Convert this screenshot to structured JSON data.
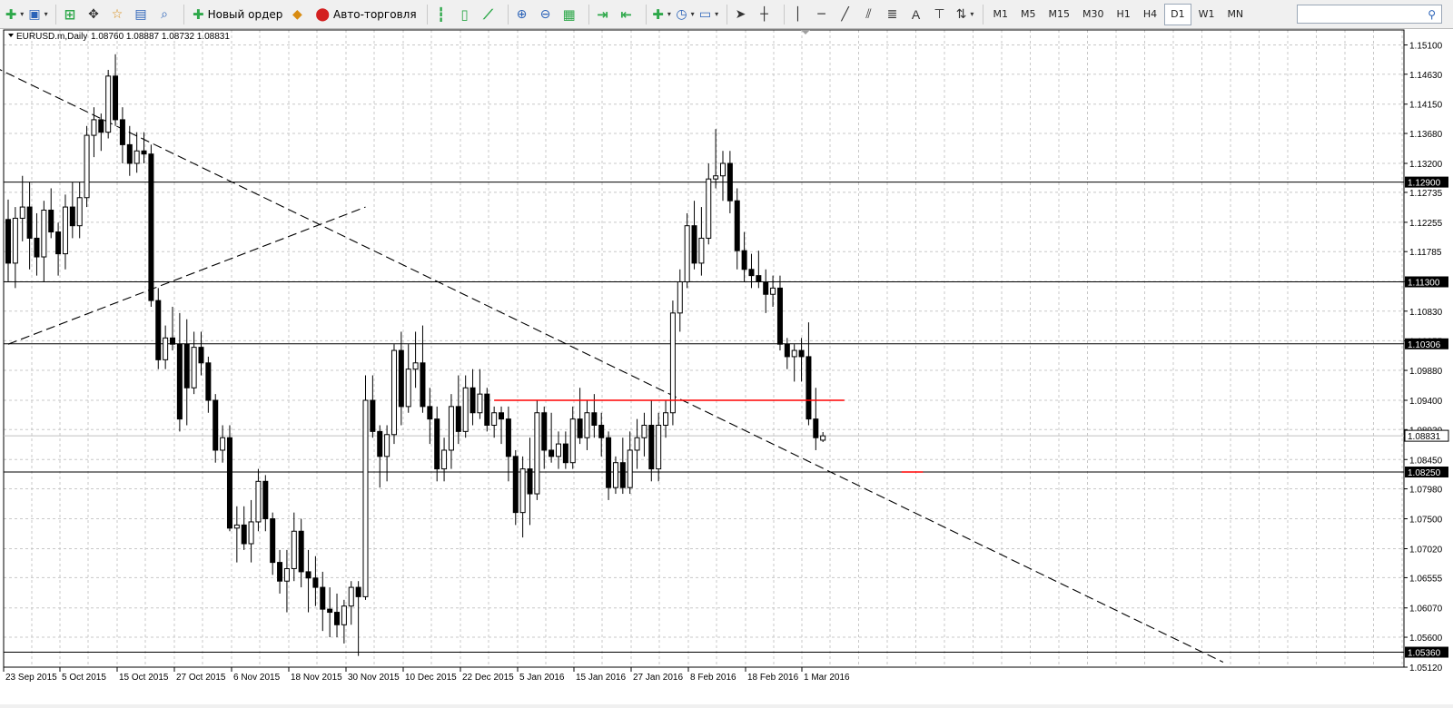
{
  "toolbar": {
    "new_order_label": "Новый ордер",
    "autotrading_label": "Авто-торговля",
    "timeframes": [
      "M1",
      "M5",
      "M15",
      "M30",
      "H1",
      "H4",
      "D1",
      "W1",
      "MN"
    ],
    "active_timeframe": "D1",
    "search_placeholder": ""
  },
  "chart_data": {
    "type": "candlestick",
    "symbol_label": "EURUSD.m,Daily",
    "ohlc_label": "1.08760 1.08887 1.08732 1.08831",
    "ylim": [
      1.0512,
      1.1534
    ],
    "y_ticks": [
      "1.15100",
      "1.14630",
      "1.14150",
      "1.13680",
      "1.13200",
      "1.12735",
      "1.12255",
      "1.11785",
      "1.11305",
      "1.10830",
      "1.10355",
      "1.09880",
      "1.09400",
      "1.08930",
      "1.08450",
      "1.07980",
      "1.07500",
      "1.07020",
      "1.06555",
      "1.06070",
      "1.05600",
      "1.05120"
    ],
    "x_labels": [
      "23 Sep 2015",
      "5 Oct 2015",
      "15 Oct 2015",
      "27 Oct 2015",
      "6 Nov 2015",
      "18 Nov 2015",
      "30 Nov 2015",
      "10 Dec 2015",
      "22 Dec 2015",
      "5 Jan 2016",
      "15 Jan 2016",
      "27 Jan 2016",
      "8 Feb 2016",
      "18 Feb 2016",
      "1 Mar 2016"
    ],
    "price_levels": [
      {
        "value": 1.129,
        "label": "1.12900"
      },
      {
        "value": 1.113,
        "label": "1.11300"
      },
      {
        "value": 1.10306,
        "label": "1.10306"
      },
      {
        "value": 1.0825,
        "label": "1.08250"
      },
      {
        "value": 1.0536,
        "label": "1.05360"
      }
    ],
    "current_price": {
      "value": 1.08831,
      "label": "1.08831"
    },
    "candles": [
      [
        1.123,
        1.1262,
        1.113,
        1.116
      ],
      [
        1.116,
        1.125,
        1.112,
        1.1232
      ],
      [
        1.1232,
        1.13,
        1.1195,
        1.125
      ],
      [
        1.125,
        1.129,
        1.115,
        1.12
      ],
      [
        1.12,
        1.124,
        1.114,
        1.117
      ],
      [
        1.117,
        1.126,
        1.113,
        1.1245
      ],
      [
        1.1245,
        1.128,
        1.12,
        1.121
      ],
      [
        1.121,
        1.1225,
        1.114,
        1.1175
      ],
      [
        1.1175,
        1.127,
        1.115,
        1.125
      ],
      [
        1.125,
        1.129,
        1.12,
        1.122
      ],
      [
        1.122,
        1.129,
        1.12,
        1.1265
      ],
      [
        1.1265,
        1.138,
        1.125,
        1.1365
      ],
      [
        1.1365,
        1.141,
        1.133,
        1.139
      ],
      [
        1.139,
        1.14,
        1.134,
        1.137
      ],
      [
        1.137,
        1.147,
        1.136,
        1.146
      ],
      [
        1.146,
        1.1495,
        1.138,
        1.139
      ],
      [
        1.139,
        1.141,
        1.132,
        1.135
      ],
      [
        1.135,
        1.138,
        1.13,
        1.132
      ],
      [
        1.132,
        1.137,
        1.1305,
        1.134
      ],
      [
        1.134,
        1.137,
        1.132,
        1.1335
      ],
      [
        1.1335,
        1.135,
        1.109,
        1.11
      ],
      [
        1.11,
        1.112,
        1.099,
        1.1005
      ],
      [
        1.1005,
        1.106,
        1.099,
        1.104
      ],
      [
        1.104,
        1.109,
        1.102,
        1.103
      ],
      [
        1.103,
        1.108,
        1.089,
        1.091
      ],
      [
        1.103,
        1.107,
        1.09,
        1.096
      ],
      [
        1.096,
        1.105,
        1.095,
        1.1025
      ],
      [
        1.1025,
        1.105,
        1.098,
        1.1
      ],
      [
        1.1,
        1.101,
        1.092,
        1.094
      ],
      [
        1.094,
        1.095,
        1.084,
        1.086
      ],
      [
        1.086,
        1.09,
        1.084,
        1.088
      ],
      [
        1.088,
        1.09,
        1.073,
        1.0735
      ],
      [
        1.0735,
        1.077,
        1.068,
        1.074
      ],
      [
        1.074,
        1.077,
        1.07,
        1.071
      ],
      [
        1.071,
        1.078,
        1.068,
        1.0745
      ],
      [
        1.0745,
        1.083,
        1.073,
        1.081
      ],
      [
        1.081,
        1.082,
        1.073,
        1.075
      ],
      [
        1.075,
        1.076,
        1.066,
        1.068
      ],
      [
        1.068,
        1.07,
        1.063,
        1.065
      ],
      [
        1.065,
        1.07,
        1.06,
        1.067
      ],
      [
        1.067,
        1.076,
        1.065,
        1.073
      ],
      [
        1.073,
        1.075,
        1.064,
        1.0665
      ],
      [
        1.0665,
        1.07,
        1.06,
        1.0655
      ],
      [
        1.0655,
        1.069,
        1.061,
        1.064
      ],
      [
        1.064,
        1.0665,
        1.057,
        1.0605
      ],
      [
        1.0605,
        1.064,
        1.056,
        1.06
      ],
      [
        1.06,
        1.063,
        1.056,
        1.058
      ],
      [
        1.058,
        1.062,
        1.055,
        1.061
      ],
      [
        1.061,
        1.065,
        1.058,
        1.064
      ],
      [
        1.064,
        1.065,
        1.053,
        1.0625
      ],
      [
        1.0625,
        1.098,
        1.062,
        1.094
      ],
      [
        1.094,
        1.098,
        1.088,
        1.089
      ],
      [
        1.089,
        1.09,
        1.08,
        1.085
      ],
      [
        1.085,
        1.09,
        1.081,
        1.0885
      ],
      [
        1.0885,
        1.103,
        1.087,
        1.102
      ],
      [
        1.102,
        1.105,
        1.09,
        1.093
      ],
      [
        1.093,
        1.103,
        1.092,
        1.099
      ],
      [
        1.099,
        1.105,
        1.096,
        1.1
      ],
      [
        1.1,
        1.106,
        1.092,
        1.093
      ],
      [
        1.093,
        1.096,
        1.087,
        1.091
      ],
      [
        1.091,
        1.093,
        1.081,
        1.083
      ],
      [
        1.083,
        1.088,
        1.081,
        1.086
      ],
      [
        1.086,
        1.095,
        1.083,
        1.093
      ],
      [
        1.093,
        1.098,
        1.087,
        1.089
      ],
      [
        1.089,
        1.098,
        1.088,
        1.096
      ],
      [
        1.096,
        1.099,
        1.09,
        1.092
      ],
      [
        1.092,
        1.099,
        1.091,
        1.095
      ],
      [
        1.095,
        1.096,
        1.089,
        1.09
      ],
      [
        1.09,
        1.093,
        1.088,
        1.092
      ],
      [
        1.092,
        1.093,
        1.087,
        1.091
      ],
      [
        1.091,
        1.093,
        1.081,
        1.085
      ],
      [
        1.085,
        1.086,
        1.074,
        1.076
      ],
      [
        1.076,
        1.085,
        1.072,
        1.083
      ],
      [
        1.083,
        1.088,
        1.074,
        1.079
      ],
      [
        1.079,
        1.094,
        1.078,
        1.092
      ],
      [
        1.092,
        1.093,
        1.083,
        1.086
      ],
      [
        1.086,
        1.092,
        1.084,
        1.085
      ],
      [
        1.085,
        1.089,
        1.083,
        1.087
      ],
      [
        1.087,
        1.089,
        1.083,
        1.084
      ],
      [
        1.084,
        1.093,
        1.083,
        1.091
      ],
      [
        1.091,
        1.096,
        1.087,
        1.088
      ],
      [
        1.088,
        1.094,
        1.086,
        1.092
      ],
      [
        1.092,
        1.095,
        1.088,
        1.09
      ],
      [
        1.09,
        1.092,
        1.085,
        1.088
      ],
      [
        1.088,
        1.089,
        1.078,
        1.08
      ],
      [
        1.08,
        1.085,
        1.079,
        1.084
      ],
      [
        1.084,
        1.088,
        1.079,
        1.08
      ],
      [
        1.08,
        1.089,
        1.079,
        1.086
      ],
      [
        1.086,
        1.091,
        1.083,
        1.088
      ],
      [
        1.088,
        1.092,
        1.085,
        1.09
      ],
      [
        1.09,
        1.094,
        1.081,
        1.083
      ],
      [
        1.083,
        1.092,
        1.081,
        1.09
      ],
      [
        1.09,
        1.094,
        1.088,
        1.092
      ],
      [
        1.092,
        1.11,
        1.09,
        1.108
      ],
      [
        1.108,
        1.115,
        1.105,
        1.113
      ],
      [
        1.113,
        1.124,
        1.112,
        1.122
      ],
      [
        1.122,
        1.126,
        1.115,
        1.116
      ],
      [
        1.116,
        1.125,
        1.114,
        1.12
      ],
      [
        1.12,
        1.132,
        1.119,
        1.1295
      ],
      [
        1.1295,
        1.1375,
        1.128,
        1.13
      ],
      [
        1.13,
        1.134,
        1.126,
        1.132
      ],
      [
        1.132,
        1.134,
        1.124,
        1.126
      ],
      [
        1.126,
        1.128,
        1.115,
        1.118
      ],
      [
        1.118,
        1.121,
        1.113,
        1.115
      ],
      [
        1.115,
        1.1175,
        1.112,
        1.114
      ],
      [
        1.114,
        1.118,
        1.112,
        1.113
      ],
      [
        1.113,
        1.115,
        1.108,
        1.111
      ],
      [
        1.111,
        1.114,
        1.109,
        1.112
      ],
      [
        1.112,
        1.114,
        1.102,
        1.103
      ],
      [
        1.103,
        1.104,
        1.099,
        1.101
      ],
      [
        1.101,
        1.103,
        1.097,
        1.102
      ],
      [
        1.102,
        1.104,
        1.097,
        1.101
      ],
      [
        1.101,
        1.1065,
        1.09,
        1.091
      ],
      [
        1.091,
        1.096,
        1.086,
        1.088
      ],
      [
        1.0876,
        1.0889,
        1.0873,
        1.0883
      ]
    ],
    "trendlines": [
      {
        "style": "dashed",
        "from": [
          -2,
          1.1475
        ],
        "to": [
          170,
          1.052
        ]
      },
      {
        "style": "dashed",
        "from": [
          0,
          1.103
        ],
        "to": [
          50,
          1.125
        ]
      }
    ],
    "red_lines": [
      {
        "from": [
          68,
          1.094
        ],
        "to": [
          117,
          1.094
        ]
      },
      {
        "from": [
          125,
          1.0825
        ],
        "to": [
          128,
          1.0825
        ]
      }
    ],
    "colors": {
      "background": "#ffffff",
      "grid": "#c8c8c8",
      "candle": "#000000",
      "level_line": "#000000",
      "red_line": "#ff0000"
    }
  }
}
